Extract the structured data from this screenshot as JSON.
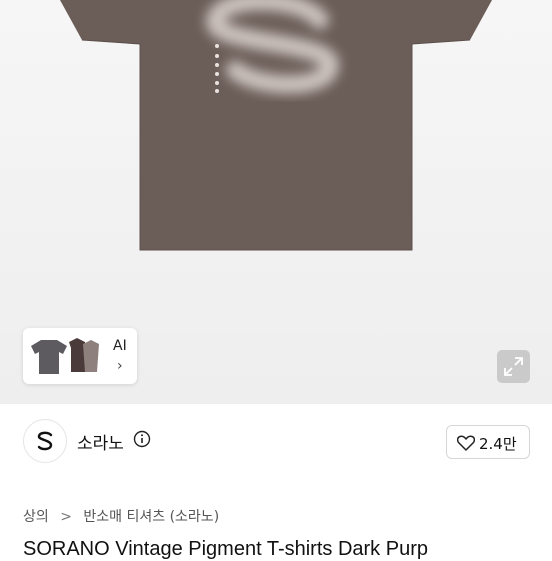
{
  "gallery": {
    "thumb_label": "AI",
    "thumb_chevron": "›",
    "expand_icon": "expand-icon",
    "shirt_color": "#6b5d58",
    "print_letter": "S"
  },
  "brand": {
    "name": "소라노",
    "info_icon": "info-icon",
    "likes": "2.4만",
    "like_icon": "heart-icon"
  },
  "breadcrumb": {
    "items": [
      "상의",
      "반소매 티셔츠 (소라노)"
    ],
    "separator": ">"
  },
  "product": {
    "title": "SORANO Vintage Pigment T-shirts Dark Purp"
  }
}
